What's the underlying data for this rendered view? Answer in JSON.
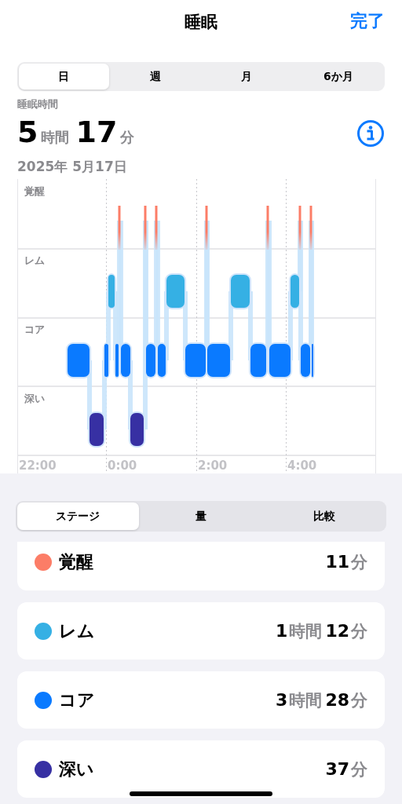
{
  "nav": {
    "title": "睡眠",
    "done": "完了"
  },
  "range_tabs": [
    {
      "label": "日",
      "selected": true
    },
    {
      "label": "週",
      "selected": false
    },
    {
      "label": "月",
      "selected": false
    },
    {
      "label": "6か月",
      "selected": false
    }
  ],
  "summary": {
    "label": "睡眠時間",
    "duration": [
      {
        "text": "5",
        "kind": "number"
      },
      {
        "text": "時間",
        "kind": "unit"
      },
      {
        "text": "17",
        "kind": "number"
      },
      {
        "text": "分",
        "kind": "unit"
      }
    ],
    "date": "2025年 5月17日"
  },
  "chart": {
    "y_labels": [
      "覚醒",
      "レム",
      "コア",
      "深い"
    ],
    "x_labels": [
      "22:00",
      "0:00",
      "2:00",
      "4:00"
    ]
  },
  "stage_tabs": [
    {
      "label": "ステージ",
      "selected": true
    },
    {
      "label": "量",
      "selected": false
    },
    {
      "label": "比較",
      "selected": false
    }
  ],
  "stages": [
    {
      "name": "覚醒",
      "color": "#fc7d67",
      "value": [
        {
          "text": "11",
          "kind": "number"
        },
        {
          "text": "分",
          "kind": "unit"
        }
      ]
    },
    {
      "name": "レム",
      "color": "#35b0e4",
      "value": [
        {
          "text": "1",
          "kind": "number"
        },
        {
          "text": "時間",
          "kind": "unit"
        },
        {
          "text": "12",
          "kind": "number"
        },
        {
          "text": "分",
          "kind": "unit"
        }
      ]
    },
    {
      "name": "コア",
      "color": "#0a7aff",
      "value": [
        {
          "text": "3",
          "kind": "number"
        },
        {
          "text": "時間",
          "kind": "unit"
        },
        {
          "text": "28",
          "kind": "number"
        },
        {
          "text": "分",
          "kind": "unit"
        }
      ]
    },
    {
      "name": "深い",
      "color": "#3730a3",
      "value": [
        {
          "text": "37",
          "kind": "number"
        },
        {
          "text": "分",
          "kind": "unit"
        }
      ]
    }
  ]
}
